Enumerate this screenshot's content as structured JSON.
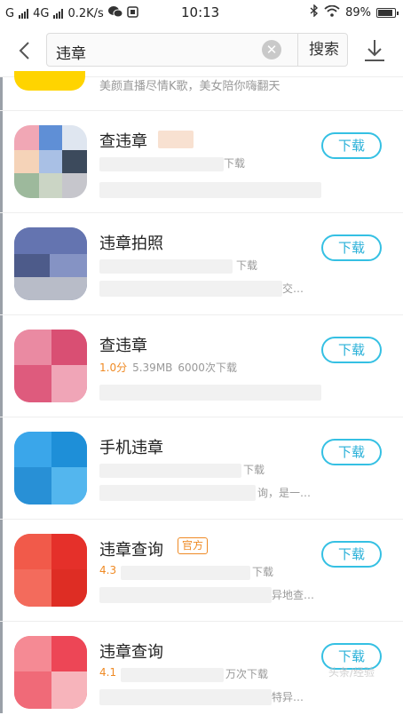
{
  "status_bar": {
    "carrier1": "G",
    "carrier2": "4G",
    "speed": "0.2K/s",
    "time": "10:13",
    "battery": "89%"
  },
  "search": {
    "query": "违章",
    "search_button": "搜索"
  },
  "partial_item": {
    "desc": "美颜直播尽情K歌，美女陪你嗨翻天"
  },
  "apps": [
    {
      "name": "查违章",
      "badge": "",
      "score": "",
      "size": "",
      "downloads": "下载",
      "desc": "",
      "download_label": "下载",
      "icon": "grid-icon"
    },
    {
      "name": "违章拍照",
      "badge": "",
      "score": "",
      "size": "",
      "downloads": "下载",
      "desc": "交…",
      "download_label": "下载",
      "icon": "camera-icon"
    },
    {
      "name": "查违章",
      "badge": "",
      "score": "1.0分",
      "size": "5.39MB",
      "downloads": "6000次下载",
      "desc": "",
      "download_label": "下载",
      "icon": "wifi-icon"
    },
    {
      "name": "手机违章",
      "badge": "",
      "score": "",
      "size": "",
      "downloads": "下载",
      "desc": "询，是一…",
      "download_label": "下载",
      "icon": "phone-icon"
    },
    {
      "name": "违章查询",
      "badge": "官方",
      "score": "4.3",
      "size": "",
      "downloads": "下载",
      "desc": "异地查…",
      "download_label": "下载",
      "icon": "car-icon"
    },
    {
      "name": "违章查询",
      "badge": "",
      "score": "4.1",
      "size": "",
      "downloads": "万次下载",
      "desc": "特异…",
      "download_label": "下载",
      "icon": "car-icon"
    }
  ],
  "watermark": "头条/经验"
}
